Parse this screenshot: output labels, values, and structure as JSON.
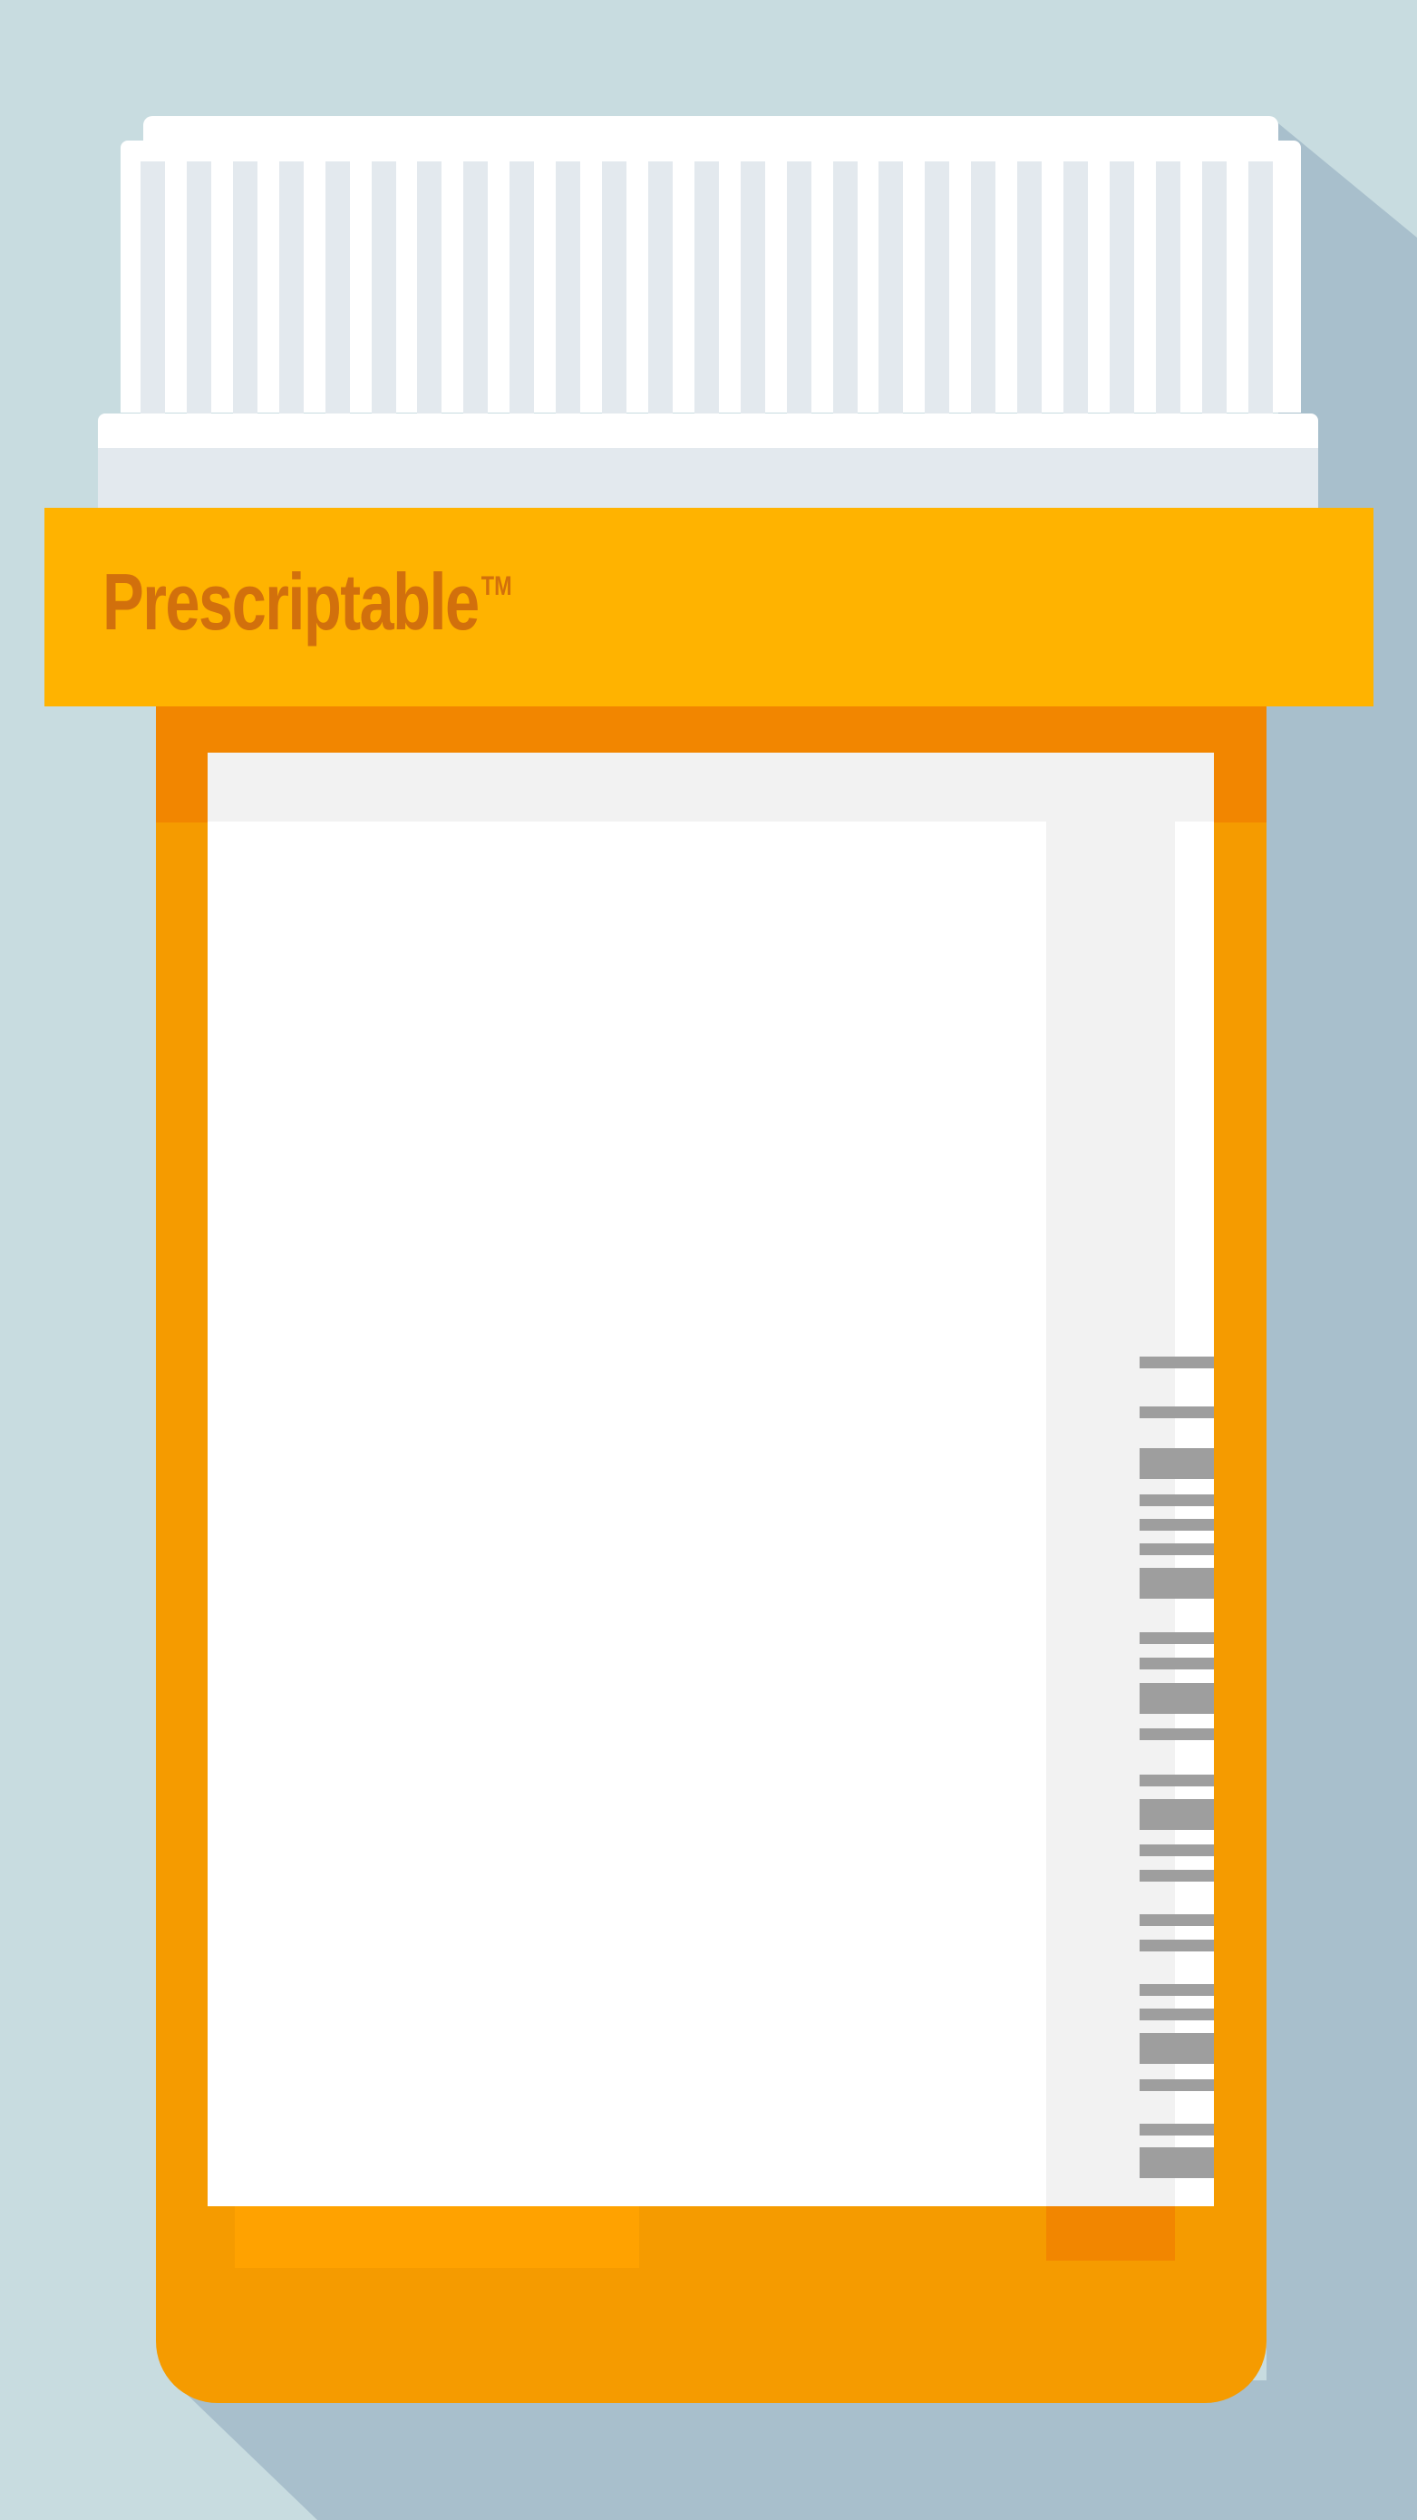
{
  "brand": {
    "name": "Prescriptable",
    "trademark": "TM"
  },
  "colors": {
    "background": "#c8dce0",
    "shadow": "#a8bfcc",
    "cap": "#ffffff",
    "cap_ridge": "#e3e9ee",
    "band": "#ffb300",
    "brand_text": "#d2700c",
    "bottle": "#f59b00",
    "bottle_dark": "#f28600",
    "label": "#ffffff",
    "label_shade": "#f2f2f2",
    "barcode": "#9e9e9e"
  },
  "icons": {
    "cap": "bottle-cap-icon",
    "barcode": "barcode-icon"
  }
}
